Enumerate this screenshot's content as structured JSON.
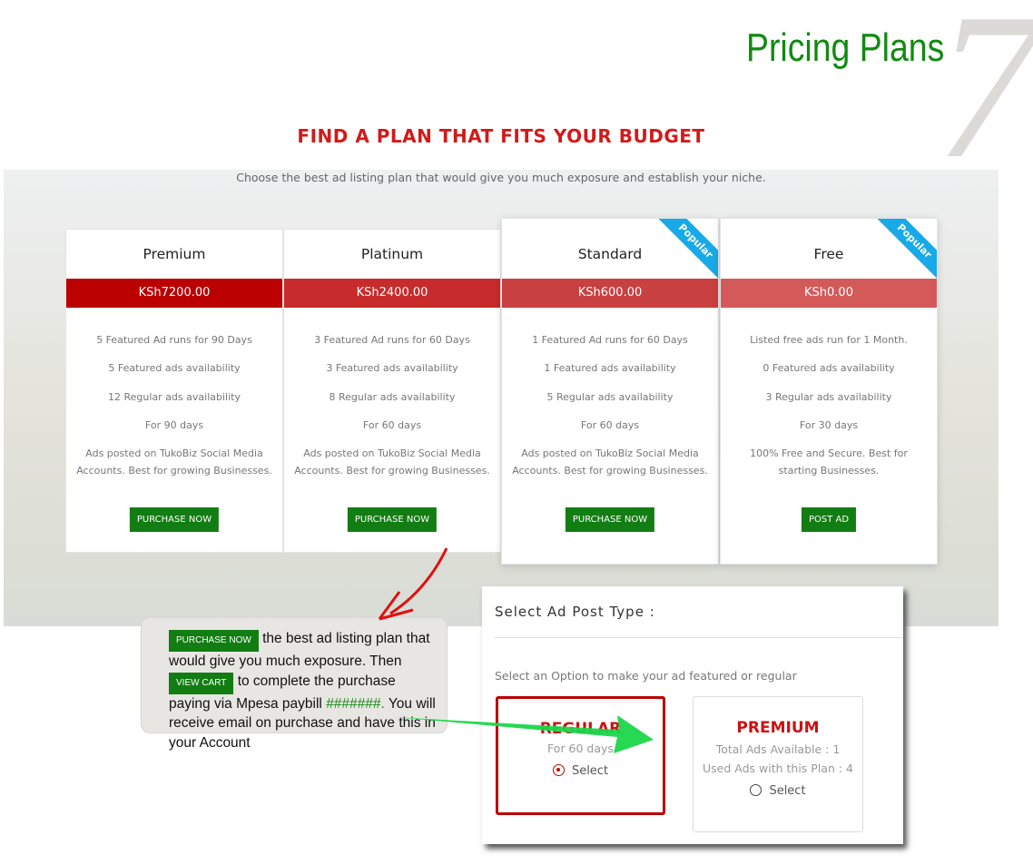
{
  "page_title": "Pricing Plans",
  "page_number": "7",
  "heading": "FIND A PLAN THAT FITS YOUR BUDGET",
  "subtitle": "Choose the best ad listing plan that would give you much exposure and establish your niche.",
  "plans": [
    {
      "name": "Premium",
      "price": "KSh7200.00",
      "price_color": "#bb0000",
      "features": [
        "5 Featured Ad runs for 90 Days",
        "5  Featured ads availability",
        "12  Regular ads availability",
        "For  90  days",
        "Ads posted on TukoBiz Social Media Accounts. Best for growing Businesses."
      ],
      "button": "PURCHASE NOW"
    },
    {
      "name": "Platinum",
      "price": "KSh2400.00",
      "price_color": "#c82b2b",
      "features": [
        "3 Featured Ad runs for 60 Days",
        "3  Featured ads availability",
        "8  Regular ads availability",
        "For  60  days",
        "Ads posted on TukoBiz Social Media Accounts. Best for growing Businesses."
      ],
      "button": "PURCHASE NOW"
    },
    {
      "name": "Standard",
      "price": "KSh600.00",
      "price_color": "#c94040",
      "badge": "Popular",
      "features": [
        "1 Featured Ad runs for 60 Days",
        "1  Featured ads availability",
        "5  Regular ads availability",
        "For  60  days",
        "Ads posted on TukoBiz Social Media Accounts. Best for growing Businesses."
      ],
      "button": "PURCHASE NOW"
    },
    {
      "name": "Free",
      "price": "KSh0.00",
      "price_color": "#d45a5a",
      "badge": "Popular",
      "features": [
        "Listed free ads run for 1 Month.",
        "0  Featured ads availability",
        "3  Regular ads availability",
        "For  30  days",
        "100% Free and Secure. Best for starting Businesses."
      ],
      "button": "POST AD"
    }
  ],
  "tooltip": {
    "btn1": "PURCHASE NOW",
    "text1": " the best ad listing plan that would give you much exposure. Then ",
    "btn2": "VIEW CART",
    "text2": " to complete the purchase paying via Mpesa paybill ",
    "paybill": "#######.",
    "text3": "  You will receive email on purchase and have this in your Account"
  },
  "modal": {
    "title": "Select Ad Post Type :",
    "instruction": "Select an Option to make your ad featured or regular",
    "regular": {
      "title": "REGULAR",
      "line": "For 60 days",
      "select": "Select",
      "selected": true
    },
    "premium": {
      "title": "PREMIUM",
      "line1": "Total Ads Available : 1",
      "line2": "Used Ads with this Plan : 4",
      "select": "Select",
      "selected": false
    }
  },
  "colors": {
    "green": "#127d12",
    "red": "#d21a1a",
    "ribbon": "#17a9e8"
  }
}
